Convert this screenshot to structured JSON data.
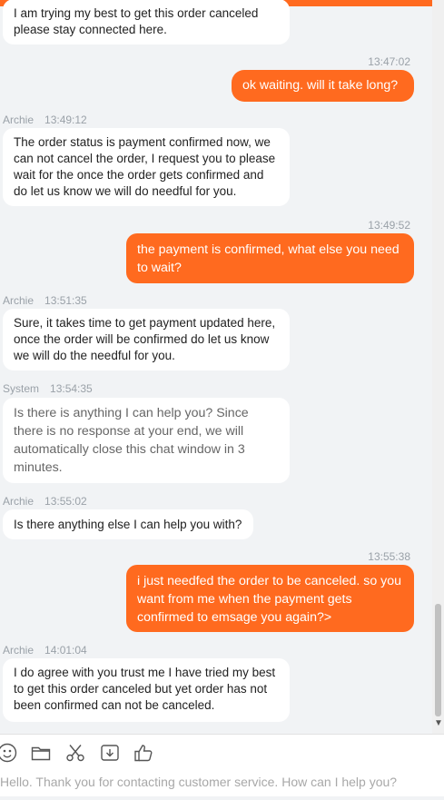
{
  "colors": {
    "accent": "#ff6a1f",
    "background": "#f1f3f5",
    "bubble_in": "#ffffff",
    "meta": "#9aa1a8"
  },
  "messages": [
    {
      "id": "m0",
      "direction": "in",
      "sender": "",
      "time": "",
      "text": "I am trying my best to get this order canceled please stay connected here."
    },
    {
      "id": "m1",
      "direction": "out",
      "sender": "",
      "time": "13:47:02",
      "text": "ok waiting. will it take long?"
    },
    {
      "id": "m2",
      "direction": "in",
      "sender": "Archie",
      "time": "13:49:12",
      "text": "The order status is payment confirmed now, we can not cancel the order, I request you to please wait for the once the order gets confirmed and do let us know we will do needful for you."
    },
    {
      "id": "m3",
      "direction": "out",
      "sender": "",
      "time": "13:49:52",
      "text": "the payment is confirmed, what else you need to wait?"
    },
    {
      "id": "m4",
      "direction": "in",
      "sender": "Archie",
      "time": "13:51:35",
      "text": "Sure, it takes time to get payment updated here, once the order will be confirmed do let us know we will do the needful for you."
    },
    {
      "id": "m5",
      "direction": "in",
      "sender": "System",
      "time": "13:54:35",
      "text": "Is there is anything I can help you? Since there is no response at your end, we will automatically close this chat window in 3 minutes."
    },
    {
      "id": "m6",
      "direction": "in",
      "sender": "Archie",
      "time": "13:55:02",
      "text": "Is there anything else I can help you with?"
    },
    {
      "id": "m7",
      "direction": "out",
      "sender": "",
      "time": "13:55:38",
      "text": "i just needfed the order to be canceled. so you want from me when the payment gets confirmed to emsage you again?>"
    },
    {
      "id": "m8",
      "direction": "in",
      "sender": "Archie",
      "time": "14:01:04",
      "text": "I do agree with you trust me I have tried my best to get this order canceled but yet order has not been confirmed can not be canceled."
    }
  ],
  "toolbar": {
    "icons": [
      "emoji-icon",
      "folder-icon",
      "scissors-icon",
      "download-icon",
      "thumbs-up-icon"
    ]
  },
  "composer": {
    "placeholder": "Hello. Thank you for contacting customer service. How can I help you?",
    "value": ""
  },
  "scroll": {
    "position_fraction": 0.93
  }
}
